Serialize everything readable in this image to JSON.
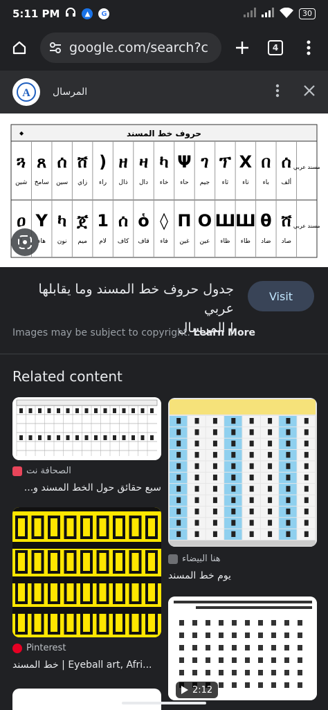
{
  "status_bar": {
    "time": "5:11 PM",
    "battery": "30"
  },
  "browser": {
    "url": "google.com/search?c",
    "tab_count": "4"
  },
  "sheet": {
    "site_name": "المرسال"
  },
  "image": {
    "table_title": "حروف خط المسند",
    "row1_label": "مسند عربي",
    "row2_label": "مسند عربي",
    "row1_names": [
      "ألف",
      "باء",
      "تاء",
      "ثاء",
      "جيم",
      "حاء",
      "خاء",
      "دال",
      "ذال",
      "راء",
      "زاي",
      "سين",
      "سامخ",
      "شين"
    ],
    "row2_names": [
      "صاد",
      "ضاد",
      "طاء",
      "ظاء",
      "عين",
      "غين",
      "فاء",
      "قاف",
      "كاف",
      "لام",
      "ميم",
      "نون",
      "هاء",
      "واو"
    ],
    "row1_glyphs": [
      "ሰ",
      "በ",
      "X",
      "ፕ",
      "ገ",
      "Ψ",
      "ካ",
      "ዛ",
      "ዘ",
      ")",
      "ሸ",
      "ሰ",
      "ጸ",
      "ጓ"
    ],
    "row2_glyphs": [
      "ሸ",
      "θ",
      "Ш",
      "Ш",
      "O",
      "П",
      "◊",
      "ὁ",
      "ሰ",
      "1",
      "ጀ",
      "ካ",
      "Y",
      "ዐ"
    ]
  },
  "result": {
    "title_line1": "جدول حروف خط المسند وما يقابلها عربي",
    "title_line2": "| المرسال",
    "visit_label": "Visit",
    "copyright_text": "Images may be subject to copyright.",
    "learn_more": "Learn More"
  },
  "related": {
    "heading": "Related content",
    "cards": [
      {
        "source": "الصحافة نت",
        "caption": "سبع حقائق حول الخط المسند و..."
      },
      {
        "source": "هنا البيضاء",
        "caption": "يوم خط المسند"
      },
      {
        "source": "Pinterest",
        "caption": "خط المسند | Eyeball art, Afri..."
      },
      {
        "source": "",
        "caption": ""
      }
    ],
    "video_duration": "2:12"
  },
  "colors": {
    "background": "#202124",
    "visit_bg": "#394457",
    "visit_text": "#c2e7ff",
    "thumb_yellow": "#ffe600",
    "thumb_blue": "#8fd0ef"
  }
}
